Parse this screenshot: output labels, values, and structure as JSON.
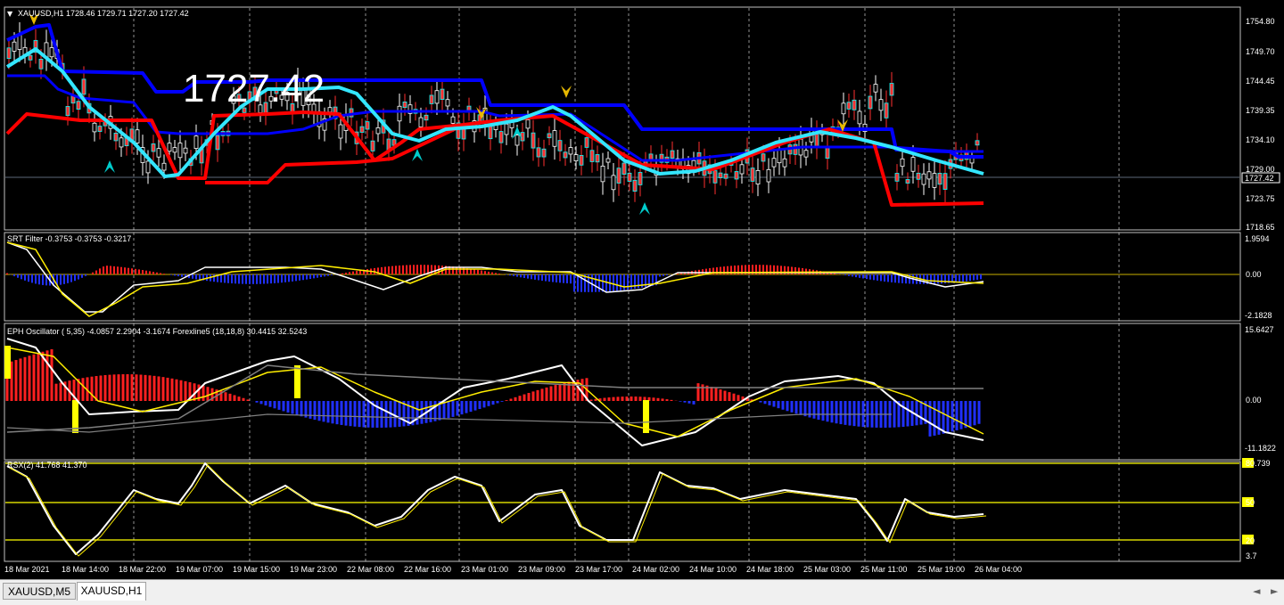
{
  "symbol_header": "XAUUSD,H1  1728.46 1729.71 1727.20 1727.42",
  "price_overlay": "1727.42",
  "current_price_label": "1727.42",
  "price_axis": [
    "1754.80",
    "1749.70",
    "1744.45",
    "1739.35",
    "1734.10",
    "1729.00",
    "1723.75",
    "1718.65"
  ],
  "srt_panel": {
    "label": "SRT  Filter -0.3753 -0.3753 -0.3217",
    "axis": [
      "1.9594",
      "0.00",
      "-2.1828"
    ]
  },
  "osc_panel": {
    "label": "EPH Oscillator ( 5,35) -4.0857 2.2904 -3.1674  Forexline5 (18,18,8) 30.4415 32.5243",
    "axis": [
      "15.6427",
      "0.00",
      "-11.1822"
    ]
  },
  "rsx_panel": {
    "label": "RSX(2) 41.768 41.370",
    "axis": [
      "80.739",
      "50",
      "20",
      "3.7"
    ],
    "levels": [
      "80",
      "50",
      "20"
    ]
  },
  "time_axis": [
    "18 Mar 2021",
    "18 Mar 14:00",
    "18 Mar 22:00",
    "19 Mar 07:00",
    "19 Mar 15:00",
    "19 Mar 23:00",
    "22 Mar 08:00",
    "22 Mar 16:00",
    "23 Mar 01:00",
    "23 Mar 09:00",
    "23 Mar 17:00",
    "24 Mar 02:00",
    "24 Mar 10:00",
    "24 Mar 18:00",
    "25 Mar 03:00",
    "25 Mar 11:00",
    "25 Mar 19:00",
    "26 Mar 04:00"
  ],
  "tabs": [
    "XAUUSD,M5",
    "XAUUSD,H1"
  ],
  "icons": {
    "scroll_left": "scroll-left-icon",
    "scroll_right": "scroll-right-icon",
    "menu": "dropdown-triangle-icon"
  },
  "colors": {
    "background": "#000000",
    "bull": "#00ffff",
    "bear": "#ff0000",
    "blue_band": "#0000ff",
    "yellow": "#ffff00",
    "grid": "#ffffff"
  }
}
